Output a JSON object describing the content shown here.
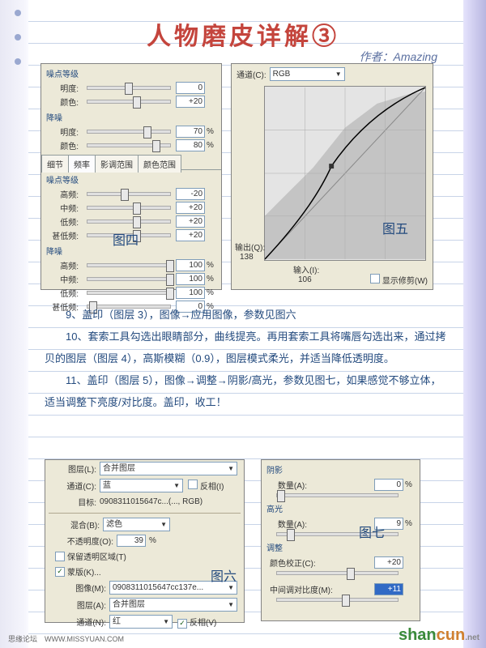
{
  "title": "人物磨皮详解③",
  "author": "作者：Amazing",
  "fig4_label": "图四",
  "fig5_label": "图五",
  "fig6_label": "图六",
  "fig7_label": "图七",
  "panel4": {
    "tabs": [
      "细节",
      "频率",
      "影调范围",
      "颜色范围"
    ],
    "noise_group": "噪点等级",
    "reduce_group": "降噪",
    "brightness": "明度:",
    "color": "颜色:",
    "high": "高频:",
    "mid": "中频:",
    "low": "低频:",
    "vlow": "甚低频:",
    "top": {
      "b_val": "0",
      "c_val": "+20",
      "rb_val": "70",
      "rc_val": "80"
    },
    "bot": {
      "h": "-20",
      "m": "+20",
      "l": "+20",
      "vl": "+20",
      "rh": "100",
      "rm": "100",
      "rl": "100",
      "rvl": "0"
    }
  },
  "panel5": {
    "channel_label": "通道(C):",
    "channel_val": "RGB",
    "output_label": "输出(Q):",
    "output_val": "138",
    "input_label": "输入(I):",
    "input_val": "106",
    "showclip": "显示修剪(W)"
  },
  "body": {
    "p1": "9、盖印（图层 3），图像→应用图像，参数见图六",
    "p2": "10、套索工具勾选出眼睛部分，曲线提亮。再用套索工具将嘴唇勾选出来，通过拷贝的图层（图层 4），高斯模糊（0.9），图层模式柔光，并适当降低透明度。",
    "p3": "11、盖印（图层 5），图像→调整→阴影/高光，参数见图七，如果感觉不够立体，适当调整下亮度/对比度。盖印，收工！"
  },
  "panel6": {
    "layer_label": "图层(L):",
    "layer_val": "合并图层",
    "channel_label": "通道(C):",
    "channel_val": "蓝",
    "invert": "反相(I)",
    "target_label": "目标:",
    "target_val": "0908311015647c...(..., RGB)",
    "blend_label": "混合(B):",
    "blend_val": "滤色",
    "opacity_label": "不透明度(O):",
    "opacity_val": "39",
    "pct": "%",
    "preserve": "保留透明区域(T)",
    "mask": "蒙版(K)...",
    "image_label": "图像(M):",
    "image_val": "0908311015647cc137e...",
    "layer2_label": "图层(A):",
    "layer2_val": "合并图层",
    "channel2_label": "通道(N):",
    "channel2_val": "红",
    "invert2": "反相(V)"
  },
  "panel7": {
    "shadow": "阴影",
    "amount": "数量(A):",
    "shadow_val": "0",
    "highlight": "高光",
    "amount2": "数量(A):",
    "highlight_val": "9",
    "adjust": "调整",
    "colorcorr": "颜色校正(C):",
    "cc_val": "+20",
    "midtone": "中间调对比度(M):",
    "mt_val": "+11",
    "pct": "%"
  },
  "footer": "思缘论坛　WWW.MISSYUAN.COM",
  "wm1": "shan",
  "wm2": "cun",
  "wm3": ".net"
}
